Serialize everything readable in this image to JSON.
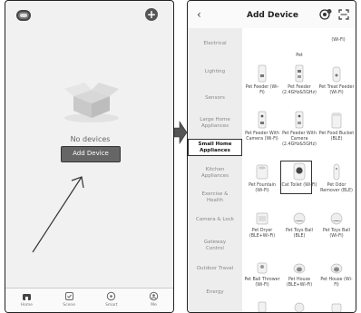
{
  "left_phone": {
    "empty_text": "No devices",
    "add_button": "Add Device",
    "nav": [
      {
        "label": "Home",
        "icon": "home-icon"
      },
      {
        "label": "Scene",
        "icon": "scene-icon"
      },
      {
        "label": "Smart",
        "icon": "smart-icon"
      },
      {
        "label": "Me",
        "icon": "me-icon"
      }
    ]
  },
  "right_phone": {
    "title": "Add Device",
    "categories": [
      "Electrical",
      "Lighting",
      "Sensors",
      "Large Home Appliances",
      "Small Home Appliances",
      "Kitchen Appliances",
      "Exercise & Health",
      "Camera & Lock",
      "Gateway Control",
      "Outdoor Travel",
      "Energy"
    ],
    "active_category": "Small Home Appliances",
    "top_label": "(Wi-Fi)",
    "section_label": "Pet",
    "devices": [
      {
        "label": "Pet Feeder (Wi-Fi)"
      },
      {
        "label": "Pet Feeder (2.4GHz&5GHz)"
      },
      {
        "label": "Pet Treat Feeder (Wi-Fi)"
      },
      {
        "label": "Pet Feeder With Camera (Wi-Fi)"
      },
      {
        "label": "Pet Feeder With Camera (2.4GHz&5GHz)"
      },
      {
        "label": "Pet Food Bucket (BLE)"
      },
      {
        "label": "Pet Fountain (Wi-Fi)"
      },
      {
        "label": "Cat Toilet (Wi-Fi)"
      },
      {
        "label": "Pet Odor Remover (BLE)"
      },
      {
        "label": "Pet Dryer (BLE+Wi-Fi)"
      },
      {
        "label": "Pet Toys Ball (BLE)"
      },
      {
        "label": "Pet Toys Ball (Wi-Fi)"
      },
      {
        "label": "Pet Ball Thrower (Wi-Fi)"
      },
      {
        "label": "Pet House (BLE+Wi-Fi)"
      },
      {
        "label": "Pet House (Wi-Fi)"
      }
    ]
  }
}
